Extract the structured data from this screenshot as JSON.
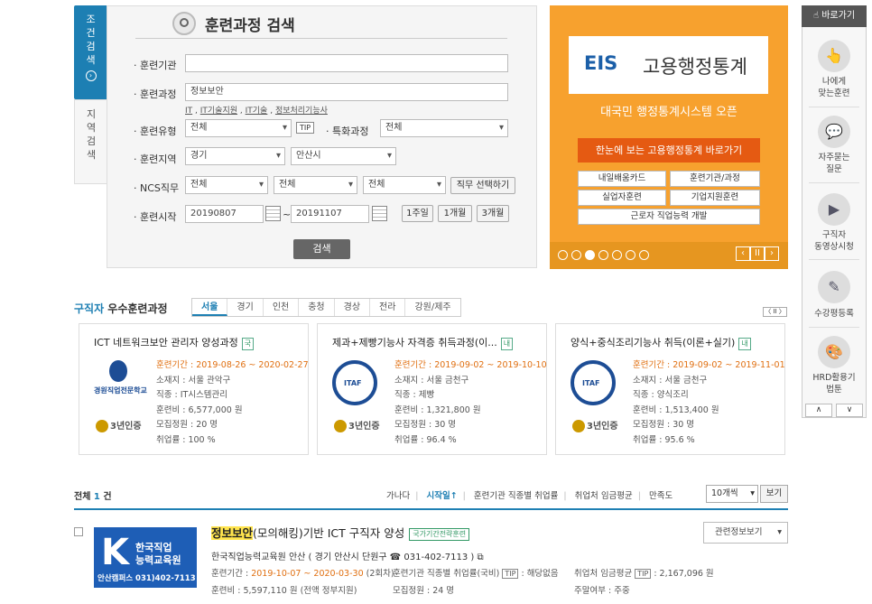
{
  "sidetabs": {
    "active": "조\n건\n검\n색",
    "inactive": "지\n역\n검\n색"
  },
  "search": {
    "title": "훈련과정 검색",
    "labels": {
      "institution": "· 훈련기관",
      "course": "· 훈련과정",
      "type": "· 훈련유형",
      "special": "· 특화과정",
      "region": "· 훈련지역",
      "ncs": "· NCS직무",
      "start": "· 훈련시작"
    },
    "course_value": "정보보안",
    "keyword_links": [
      "IT",
      "IT기술지원",
      "IT기술",
      "정보처리기능사"
    ],
    "type_value": "전체",
    "special_value": "전체",
    "region1": "경기",
    "region2": "안산시",
    "ncs1": "전체",
    "ncs2": "전체",
    "ncs3": "전체",
    "ncs_btn": "직무 선택하기",
    "tip": "TIP",
    "date_from": "20190807",
    "date_to": "20191107",
    "tilde": "~",
    "period_btns": [
      "1주일",
      "1개월",
      "3개월"
    ],
    "submit": "검색"
  },
  "banner": {
    "logo_eis": "EIS",
    "logo_text": "고용행정통계",
    "subtitle": "대국민 행정통계시스템 오픈",
    "main_btn": "한눈에 보는 고용행정통계 바로가기",
    "small_btns": [
      "내일배움카드",
      "훈련기관/과정",
      "실업자훈련",
      "기업지원훈련"
    ],
    "wide_btn": "근로자 직업능력 개발",
    "dots": 7,
    "active_dot": 2
  },
  "quick": {
    "head": "바로가기",
    "items": [
      {
        "label": "나에게\n맞는훈련",
        "icon": "👆"
      },
      {
        "label": "자주묻는\n질문",
        "icon": "💬"
      },
      {
        "label": "구직자\n동영상시청",
        "icon": "▶"
      },
      {
        "label": "수강평등록",
        "icon": "✎"
      },
      {
        "label": "HRD활용기\n법툰",
        "icon": "🎨"
      }
    ]
  },
  "recommend": {
    "title_a": "구직자",
    "title_b": " 우수훈련과정",
    "tabs": [
      "서울",
      "경기",
      "인천",
      "충청",
      "경상",
      "전라",
      "강원/제주"
    ],
    "nav": "〈 II 〉",
    "cards": [
      {
        "title": "ICT 네트워크보안 관리자 양성과정",
        "badge": "국",
        "logo": "경원직업전문학교",
        "period": "훈련기간 : 2019-08-26 ~ 2020-02-27",
        "place": "소재지 : 서울 관악구",
        "job": "직종 : IT시스템관리",
        "fee": "훈련비 : 6,577,000 원",
        "quota": "모집정원 : 20 명",
        "rate": "취업률 : 100 %",
        "cert": "3년인증"
      },
      {
        "title": "제과+제빵기능사 자격증 취득과정(이...",
        "badge": "내",
        "logo": "",
        "period": "훈련기간 : 2019-09-02 ~ 2019-10-10",
        "place": "소재지 : 서울 금천구",
        "job": "직종 : 제빵",
        "fee": "훈련비 : 1,321,800 원",
        "quota": "모집정원 : 30 명",
        "rate": "취업률 : 96.4 %",
        "cert": "3년인증"
      },
      {
        "title": "양식+중식조리기능사 취득(이론+실기)",
        "badge": "내",
        "logo": "",
        "period": "훈련기간 : 2019-09-02 ~ 2019-11-01",
        "place": "소재지 : 서울 금천구",
        "job": "직종 : 양식조리",
        "fee": "훈련비 : 1,513,400 원",
        "quota": "모집정원 : 30 명",
        "rate": "취업률 : 95.6 %",
        "cert": "3년인증"
      }
    ]
  },
  "list": {
    "total_a": "전체",
    "total_n": "1",
    "total_b": " 건",
    "sorts": [
      "가나다",
      "시작일↑",
      "훈련기관 직종별 취업률",
      "취업처 임금평균",
      "만족도"
    ],
    "count": "10개씩",
    "view": "보기",
    "item": {
      "title_mark": "정보보안",
      "title_rest": "(모의해킹)기반 ICT 구직자 양성",
      "tag": "국가기간전략훈련",
      "logo_k": "K",
      "logo_n1": "한국직업",
      "logo_n2": "능력교육원",
      "logo_ph": "안산캠퍼스 031)402-7113",
      "inst": "한국직업능력교육원 안산 ( 경기 안산시 단원구 ☎ 031-402-7113 )",
      "period_label": "훈련기간 : ",
      "period": "2019-10-07 ~ 2020-03-30",
      "round": " (2회차)",
      "emp_rate": "훈련기관 직종별 취업률(국비)",
      "tip": "TIP",
      "emp_val": " : 해당없음",
      "wage": "취업처 임금평균",
      "wage_val": " : 2,167,096 원",
      "fee": "훈련비 : 5,597,110 원 (전액 정부지원)",
      "quota": "모집정원 : 24 명",
      "weekend": "주말여부 : 주중",
      "rel": "관련정보보기"
    }
  }
}
